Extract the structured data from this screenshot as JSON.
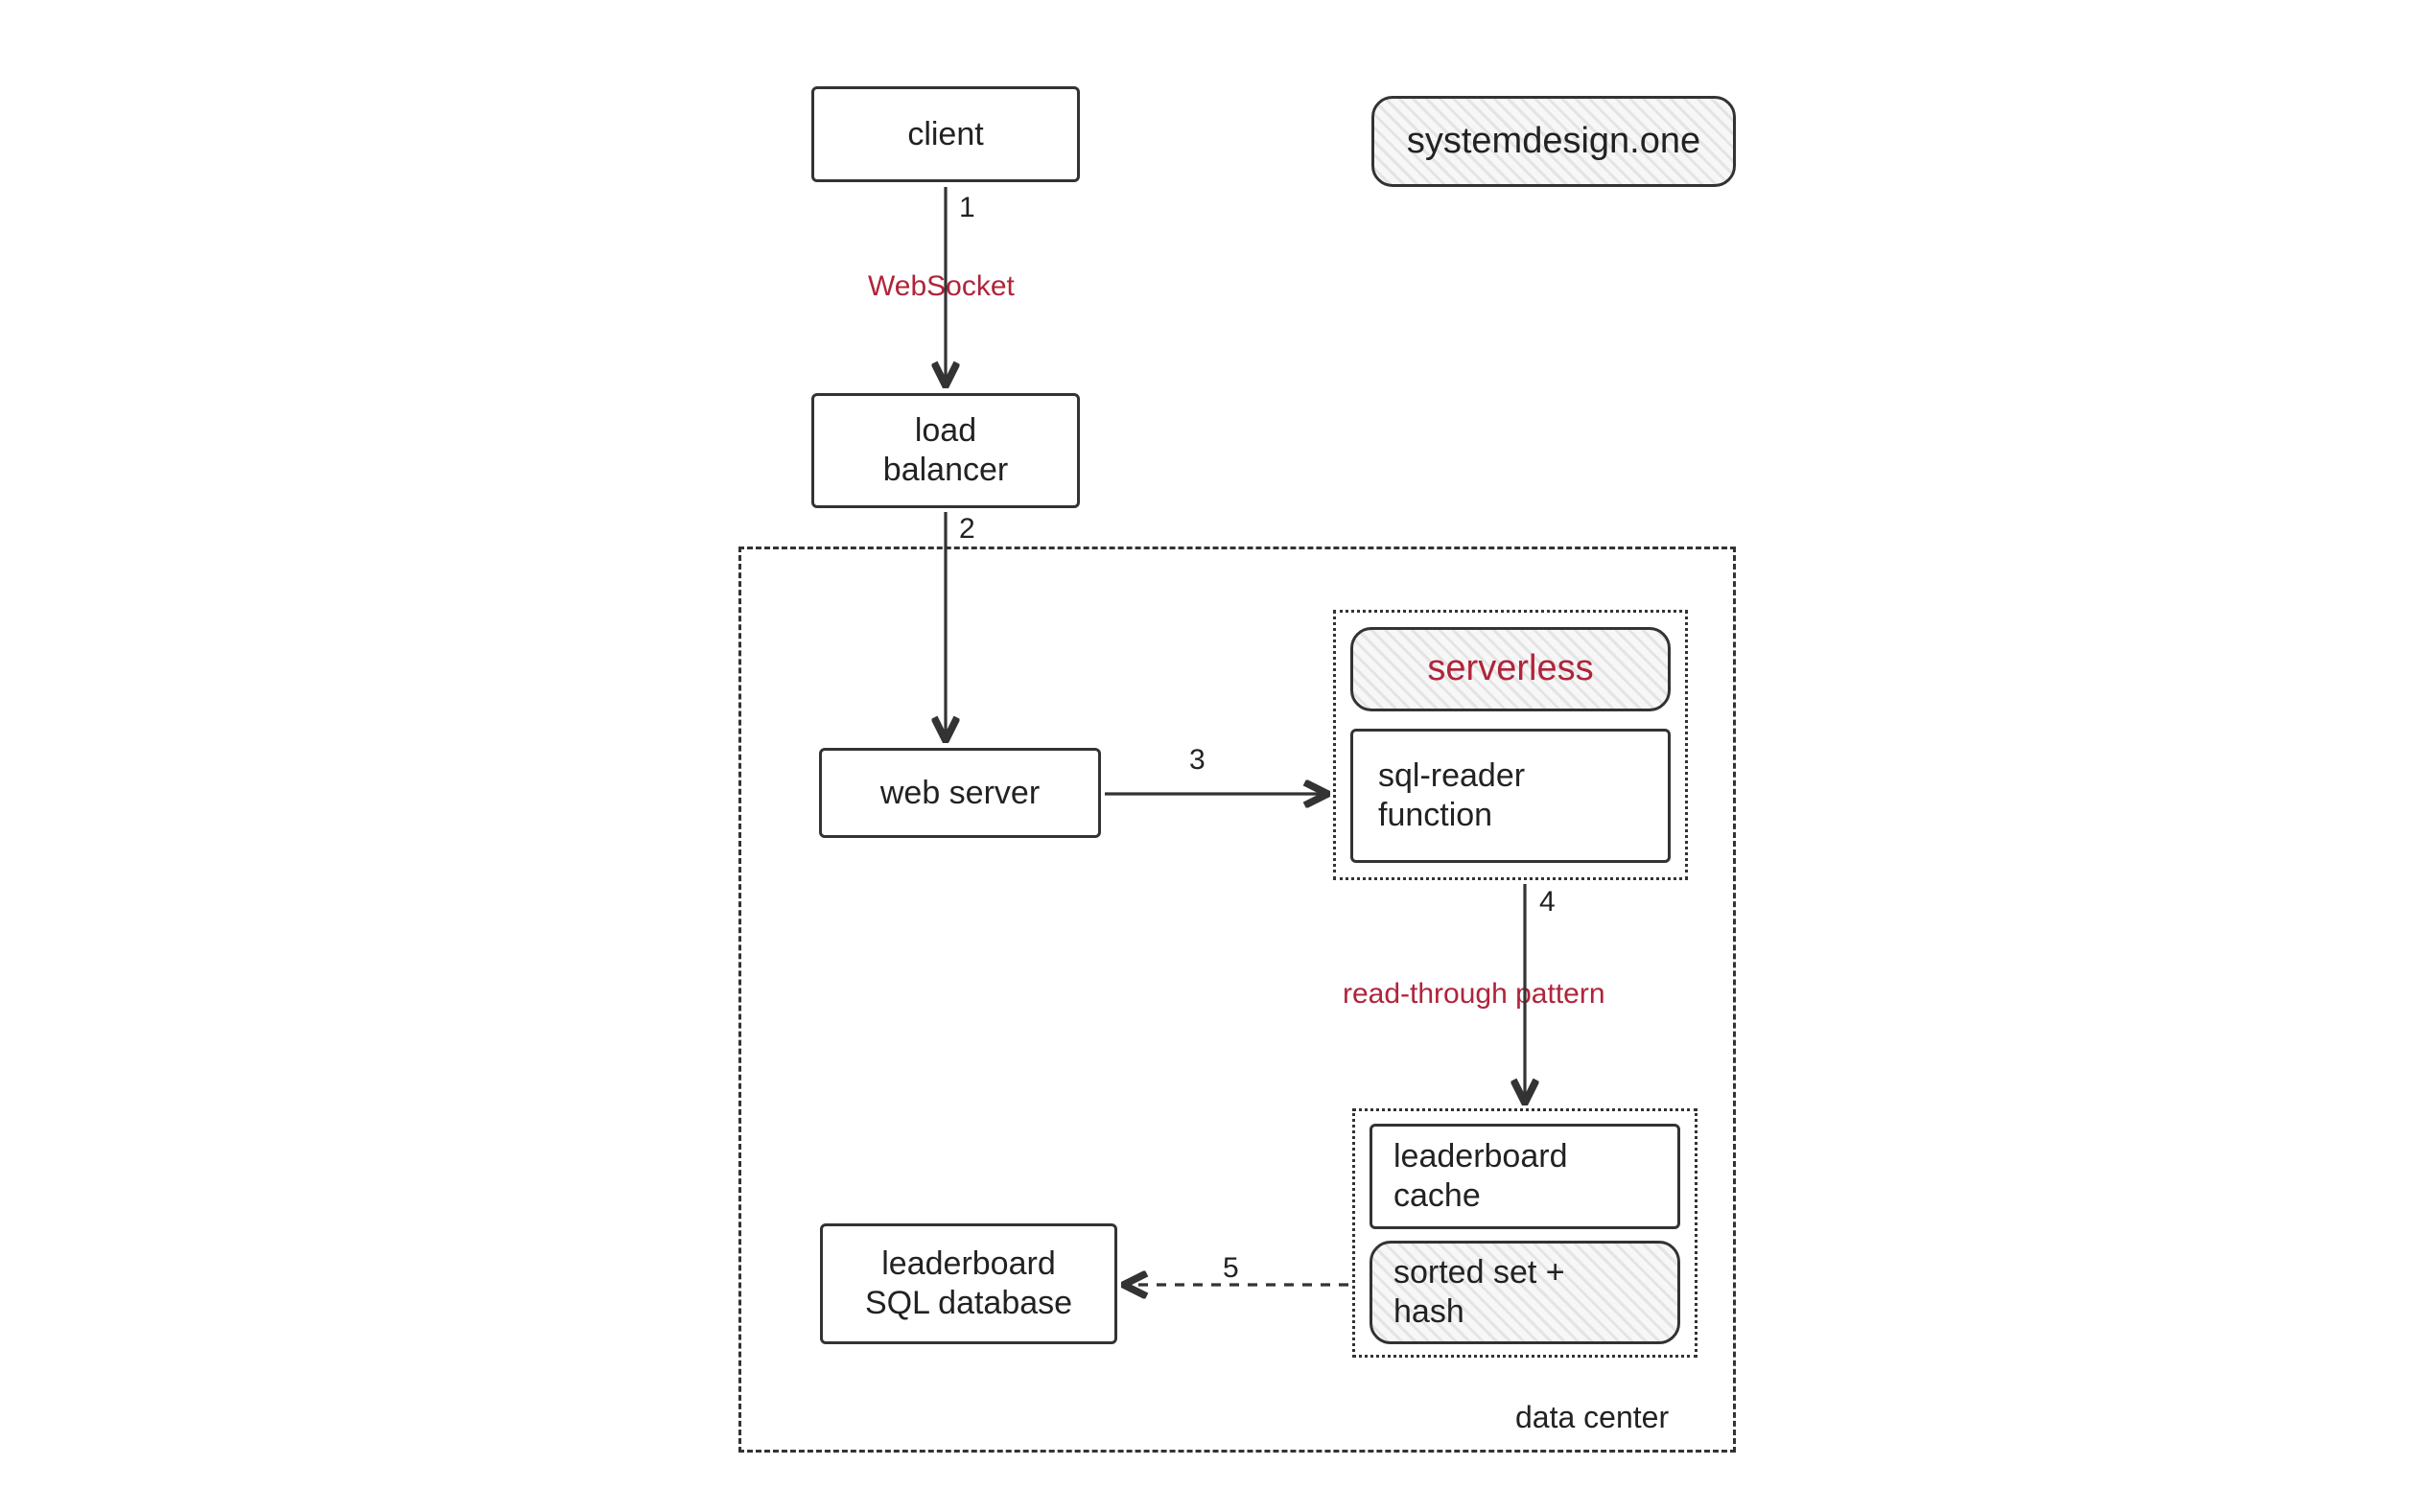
{
  "brand": "systemdesign.one",
  "nodes": {
    "client": "client",
    "load_balancer": "load\nbalancer",
    "web_server": "web server",
    "serverless": "serverless",
    "sql_reader_function": "sql-reader\nfunction",
    "leaderboard_cache": "leaderboard\ncache",
    "sorted_set_hash": "sorted set +\nhash",
    "leaderboard_sql_db": "leaderboard\nSQL database"
  },
  "edges": {
    "e1": {
      "num": "1",
      "label": "WebSocket"
    },
    "e2": {
      "num": "2"
    },
    "e3": {
      "num": "3"
    },
    "e4": {
      "num": "4",
      "label": "read-through pattern"
    },
    "e5": {
      "num": "5"
    }
  },
  "groups": {
    "data_center": "data center"
  }
}
